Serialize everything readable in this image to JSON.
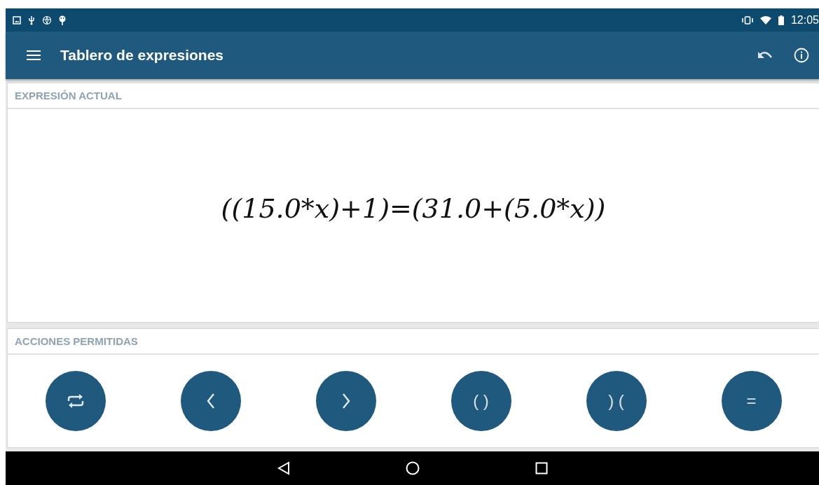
{
  "status_bar": {
    "time": "12:05"
  },
  "app_bar": {
    "title": "Tablero de expresiones"
  },
  "expression_card": {
    "heading": "EXPRESIÓN ACTUAL",
    "expression": "((15.0*x)+1)=(31.0+(5.0*x))"
  },
  "actions_card": {
    "heading": "ACCIONES PERMITIDAS",
    "buttons": [
      {
        "kind": "swap"
      },
      {
        "kind": "left"
      },
      {
        "kind": "right"
      },
      {
        "kind": "text",
        "label": "( )"
      },
      {
        "kind": "text",
        "label": ") ("
      },
      {
        "kind": "text",
        "label": "="
      }
    ]
  }
}
